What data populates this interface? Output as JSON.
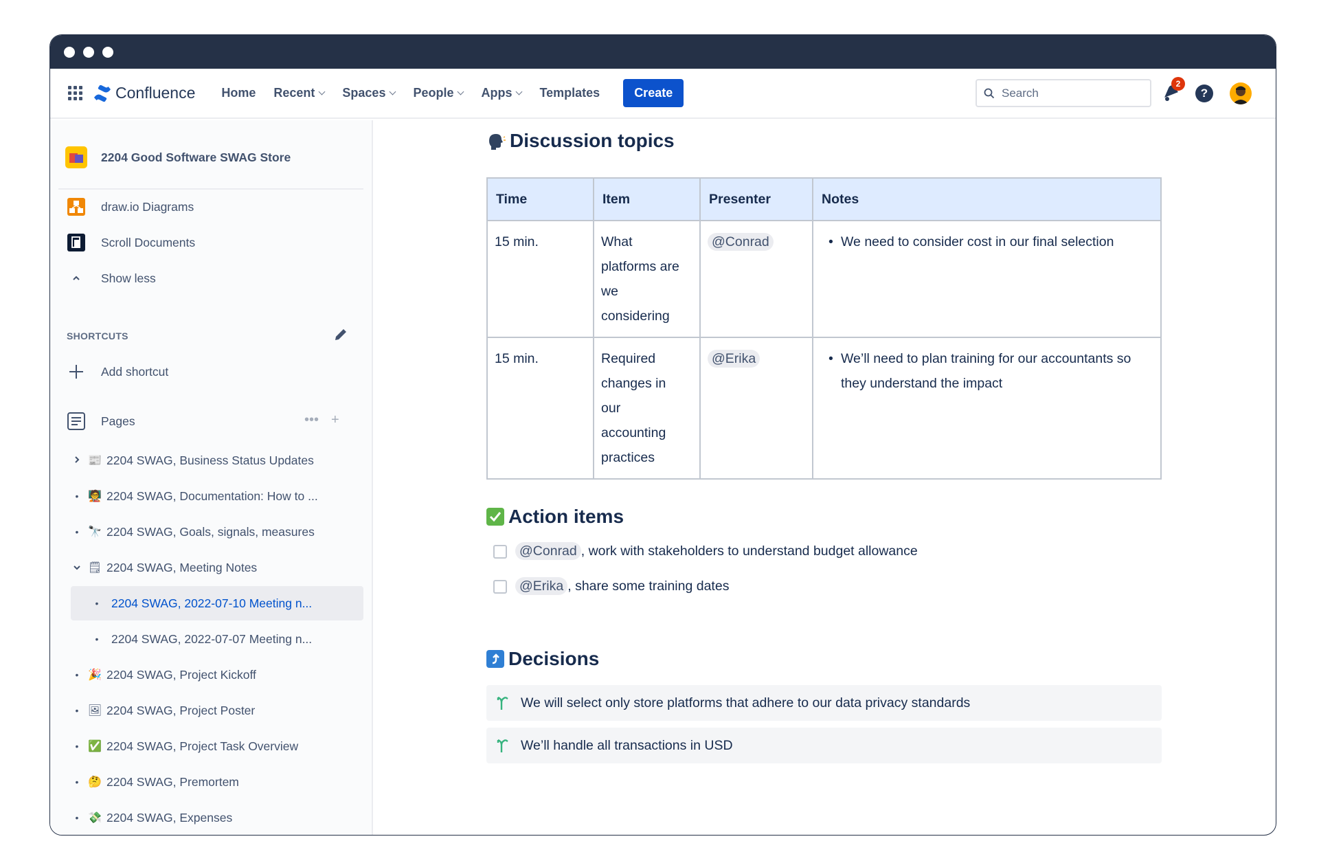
{
  "nav": {
    "logo_text": "Confluence",
    "items": [
      {
        "label": "Home",
        "dropdown": false
      },
      {
        "label": "Recent",
        "dropdown": true
      },
      {
        "label": "Spaces",
        "dropdown": true
      },
      {
        "label": "People",
        "dropdown": true
      },
      {
        "label": "Apps",
        "dropdown": true
      },
      {
        "label": "Templates",
        "dropdown": false
      }
    ],
    "create_label": "Create",
    "search_placeholder": "Search",
    "notification_count": "2"
  },
  "sidebar": {
    "space_name": "2204 Good Software SWAG Store",
    "apps": [
      {
        "label": "draw.io Diagrams",
        "icon": "drawio-icon"
      },
      {
        "label": "Scroll Documents",
        "icon": "scroll-documents-icon"
      },
      {
        "label": "Show less",
        "icon": "chevron-up-icon"
      }
    ],
    "shortcuts_label": "SHORTCUTS",
    "add_shortcut_label": "Add shortcut",
    "pages_label": "Pages",
    "tree": [
      {
        "label": "2204 SWAG, Business Status Updates",
        "emoji": "📰",
        "marker": "expand",
        "level": 0
      },
      {
        "label": "2204 SWAG, Documentation: How to ...",
        "emoji": "🧑‍🏫",
        "marker": "bullet",
        "level": 0
      },
      {
        "label": "2204 SWAG, Goals, signals, measures",
        "emoji": "🔭",
        "marker": "bullet",
        "level": 0
      },
      {
        "label": "2204 SWAG, Meeting Notes",
        "emoji": "🗒",
        "marker": "collapse",
        "level": 0
      },
      {
        "label": "2204 SWAG, 2022-07-10 Meeting n...",
        "emoji": "",
        "marker": "bullet",
        "level": 1,
        "selected": true
      },
      {
        "label": "2204 SWAG, 2022-07-07 Meeting n...",
        "emoji": "",
        "marker": "bullet",
        "level": 1
      },
      {
        "label": "2204 SWAG, Project Kickoff",
        "emoji": "🎉",
        "marker": "bullet",
        "level": 0
      },
      {
        "label": "2204 SWAG, Project Poster",
        "emoji": "🖼",
        "marker": "bullet",
        "level": 0
      },
      {
        "label": "2204 SWAG, Project Task Overview",
        "emoji": "✅",
        "marker": "bullet",
        "level": 0
      },
      {
        "label": "2204 SWAG, Premortem",
        "emoji": "🤔",
        "marker": "bullet",
        "level": 0
      },
      {
        "label": "2204 SWAG, Expenses",
        "emoji": "💸",
        "marker": "bullet",
        "level": 0
      }
    ]
  },
  "content": {
    "discussion_title": "Discussion topics",
    "table": {
      "headers": [
        "Time",
        "Item",
        "Presenter",
        "Notes"
      ],
      "rows": [
        {
          "time": "15 min.",
          "item": [
            "What",
            "platforms are",
            "we",
            "considering"
          ],
          "presenter": "@Conrad",
          "notes": [
            "We need to consider cost in our final selection"
          ]
        },
        {
          "time": "15 min.",
          "item": [
            "Required",
            "changes in",
            "our",
            "accounting",
            "practices"
          ],
          "presenter": "@Erika",
          "notes": [
            "We’ll need to plan training for our accountants so",
            "they understand the impact"
          ]
        }
      ]
    },
    "action_title": "Action items",
    "actions": [
      {
        "mention": "@Conrad",
        "text": ", work with stakeholders to understand budget allowance"
      },
      {
        "mention": "@Erika",
        "text": ", share some training dates"
      }
    ],
    "decisions_title": "Decisions",
    "decisions": [
      "We will select only store platforms that adhere to our data privacy standards",
      "We’ll handle all transactions in USD"
    ]
  },
  "colors": {
    "titlebar": "#253147",
    "accent": "#0c52cc",
    "table_header": "#deebff",
    "badge": "#de350b"
  }
}
